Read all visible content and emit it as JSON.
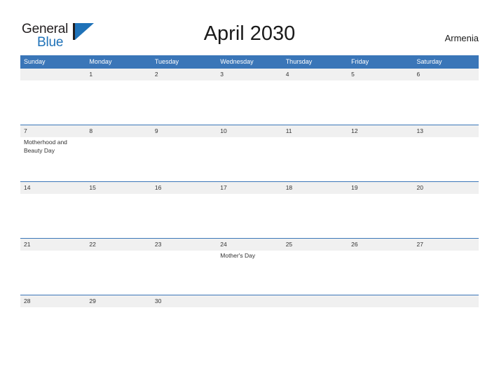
{
  "logo": {
    "word_one": "General",
    "word_two": "Blue",
    "mark": "triangle-mark",
    "color_primary": "#1f72b8",
    "color_text": "#231f20"
  },
  "header": {
    "title": "April 2030",
    "country": "Armenia"
  },
  "theme": {
    "header_blue": "#3a76b8",
    "band_gray": "#f0f0f0",
    "text": "#333333",
    "background": "#ffffff"
  },
  "calendar": {
    "weekdays": [
      "Sunday",
      "Monday",
      "Tuesday",
      "Wednesday",
      "Thursday",
      "Friday",
      "Saturday"
    ],
    "weeks": [
      [
        {
          "day": "",
          "event": ""
        },
        {
          "day": "1",
          "event": ""
        },
        {
          "day": "2",
          "event": ""
        },
        {
          "day": "3",
          "event": ""
        },
        {
          "day": "4",
          "event": ""
        },
        {
          "day": "5",
          "event": ""
        },
        {
          "day": "6",
          "event": ""
        }
      ],
      [
        {
          "day": "7",
          "event": "Motherhood and Beauty Day"
        },
        {
          "day": "8",
          "event": ""
        },
        {
          "day": "9",
          "event": ""
        },
        {
          "day": "10",
          "event": ""
        },
        {
          "day": "11",
          "event": ""
        },
        {
          "day": "12",
          "event": ""
        },
        {
          "day": "13",
          "event": ""
        }
      ],
      [
        {
          "day": "14",
          "event": ""
        },
        {
          "day": "15",
          "event": ""
        },
        {
          "day": "16",
          "event": ""
        },
        {
          "day": "17",
          "event": ""
        },
        {
          "day": "18",
          "event": ""
        },
        {
          "day": "19",
          "event": ""
        },
        {
          "day": "20",
          "event": ""
        }
      ],
      [
        {
          "day": "21",
          "event": ""
        },
        {
          "day": "22",
          "event": ""
        },
        {
          "day": "23",
          "event": ""
        },
        {
          "day": "24",
          "event": "Mother's Day"
        },
        {
          "day": "25",
          "event": ""
        },
        {
          "day": "26",
          "event": ""
        },
        {
          "day": "27",
          "event": ""
        }
      ],
      [
        {
          "day": "28",
          "event": ""
        },
        {
          "day": "29",
          "event": ""
        },
        {
          "day": "30",
          "event": ""
        },
        {
          "day": "",
          "event": ""
        },
        {
          "day": "",
          "event": ""
        },
        {
          "day": "",
          "event": ""
        },
        {
          "day": "",
          "event": ""
        }
      ]
    ]
  }
}
